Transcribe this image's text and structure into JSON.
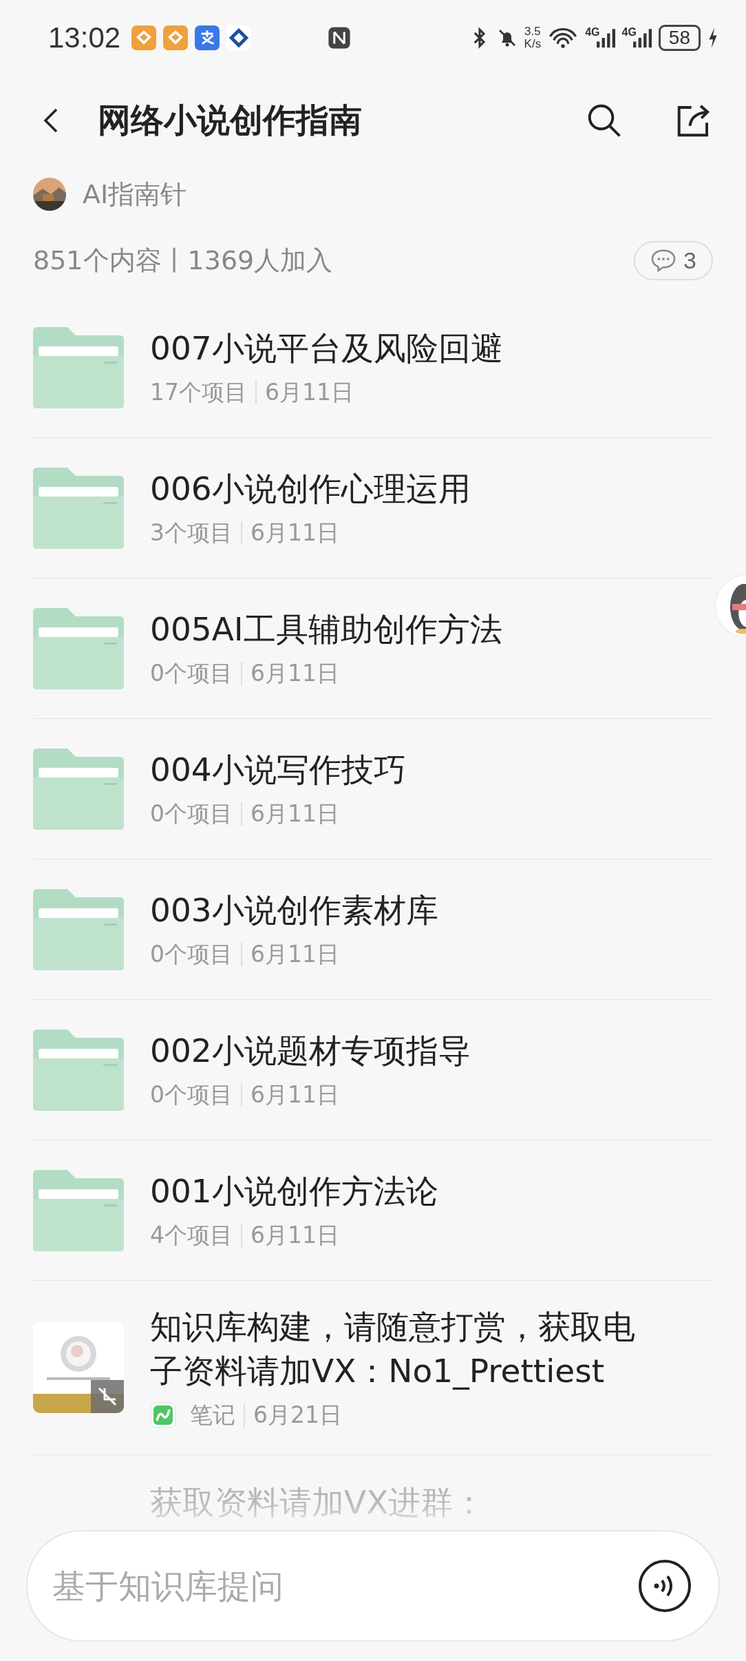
{
  "status_bar": {
    "time": "13:02",
    "speed": [
      "3.5",
      "K/s"
    ],
    "network_labels": [
      "4G",
      "4G"
    ],
    "battery": "58"
  },
  "header": {
    "title": "网络小说创作指南"
  },
  "author": {
    "name": "AI指南针"
  },
  "stats": {
    "summary": "851个内容丨1369人加入",
    "comments": "3"
  },
  "items": [
    {
      "kind": "folder",
      "title": "007小说平台及风险回避",
      "count": "17个项目",
      "date": "6月11日"
    },
    {
      "kind": "folder",
      "title": "006小说创作心理运用",
      "count": "3个项目",
      "date": "6月11日"
    },
    {
      "kind": "folder",
      "title": "005AI工具辅助创作方法",
      "count": "0个项目",
      "date": "6月11日"
    },
    {
      "kind": "folder",
      "title": "004小说写作技巧",
      "count": "0个项目",
      "date": "6月11日"
    },
    {
      "kind": "folder",
      "title": "003小说创作素材库",
      "count": "0个项目",
      "date": "6月11日"
    },
    {
      "kind": "folder",
      "title": "002小说题材专项指导",
      "count": "0个项目",
      "date": "6月11日"
    },
    {
      "kind": "folder",
      "title": "001小说创作方法论",
      "count": "4个项目",
      "date": "6月11日"
    },
    {
      "kind": "note",
      "title": "知识库构建，请随意打赏，获取电子资料请加VX：No1_Prettiest",
      "count": "笔记",
      "date": "6月21日"
    },
    {
      "kind": "faded",
      "title": "获取资料请加VX进群："
    }
  ],
  "ask": {
    "placeholder": "基于知识库提问"
  }
}
